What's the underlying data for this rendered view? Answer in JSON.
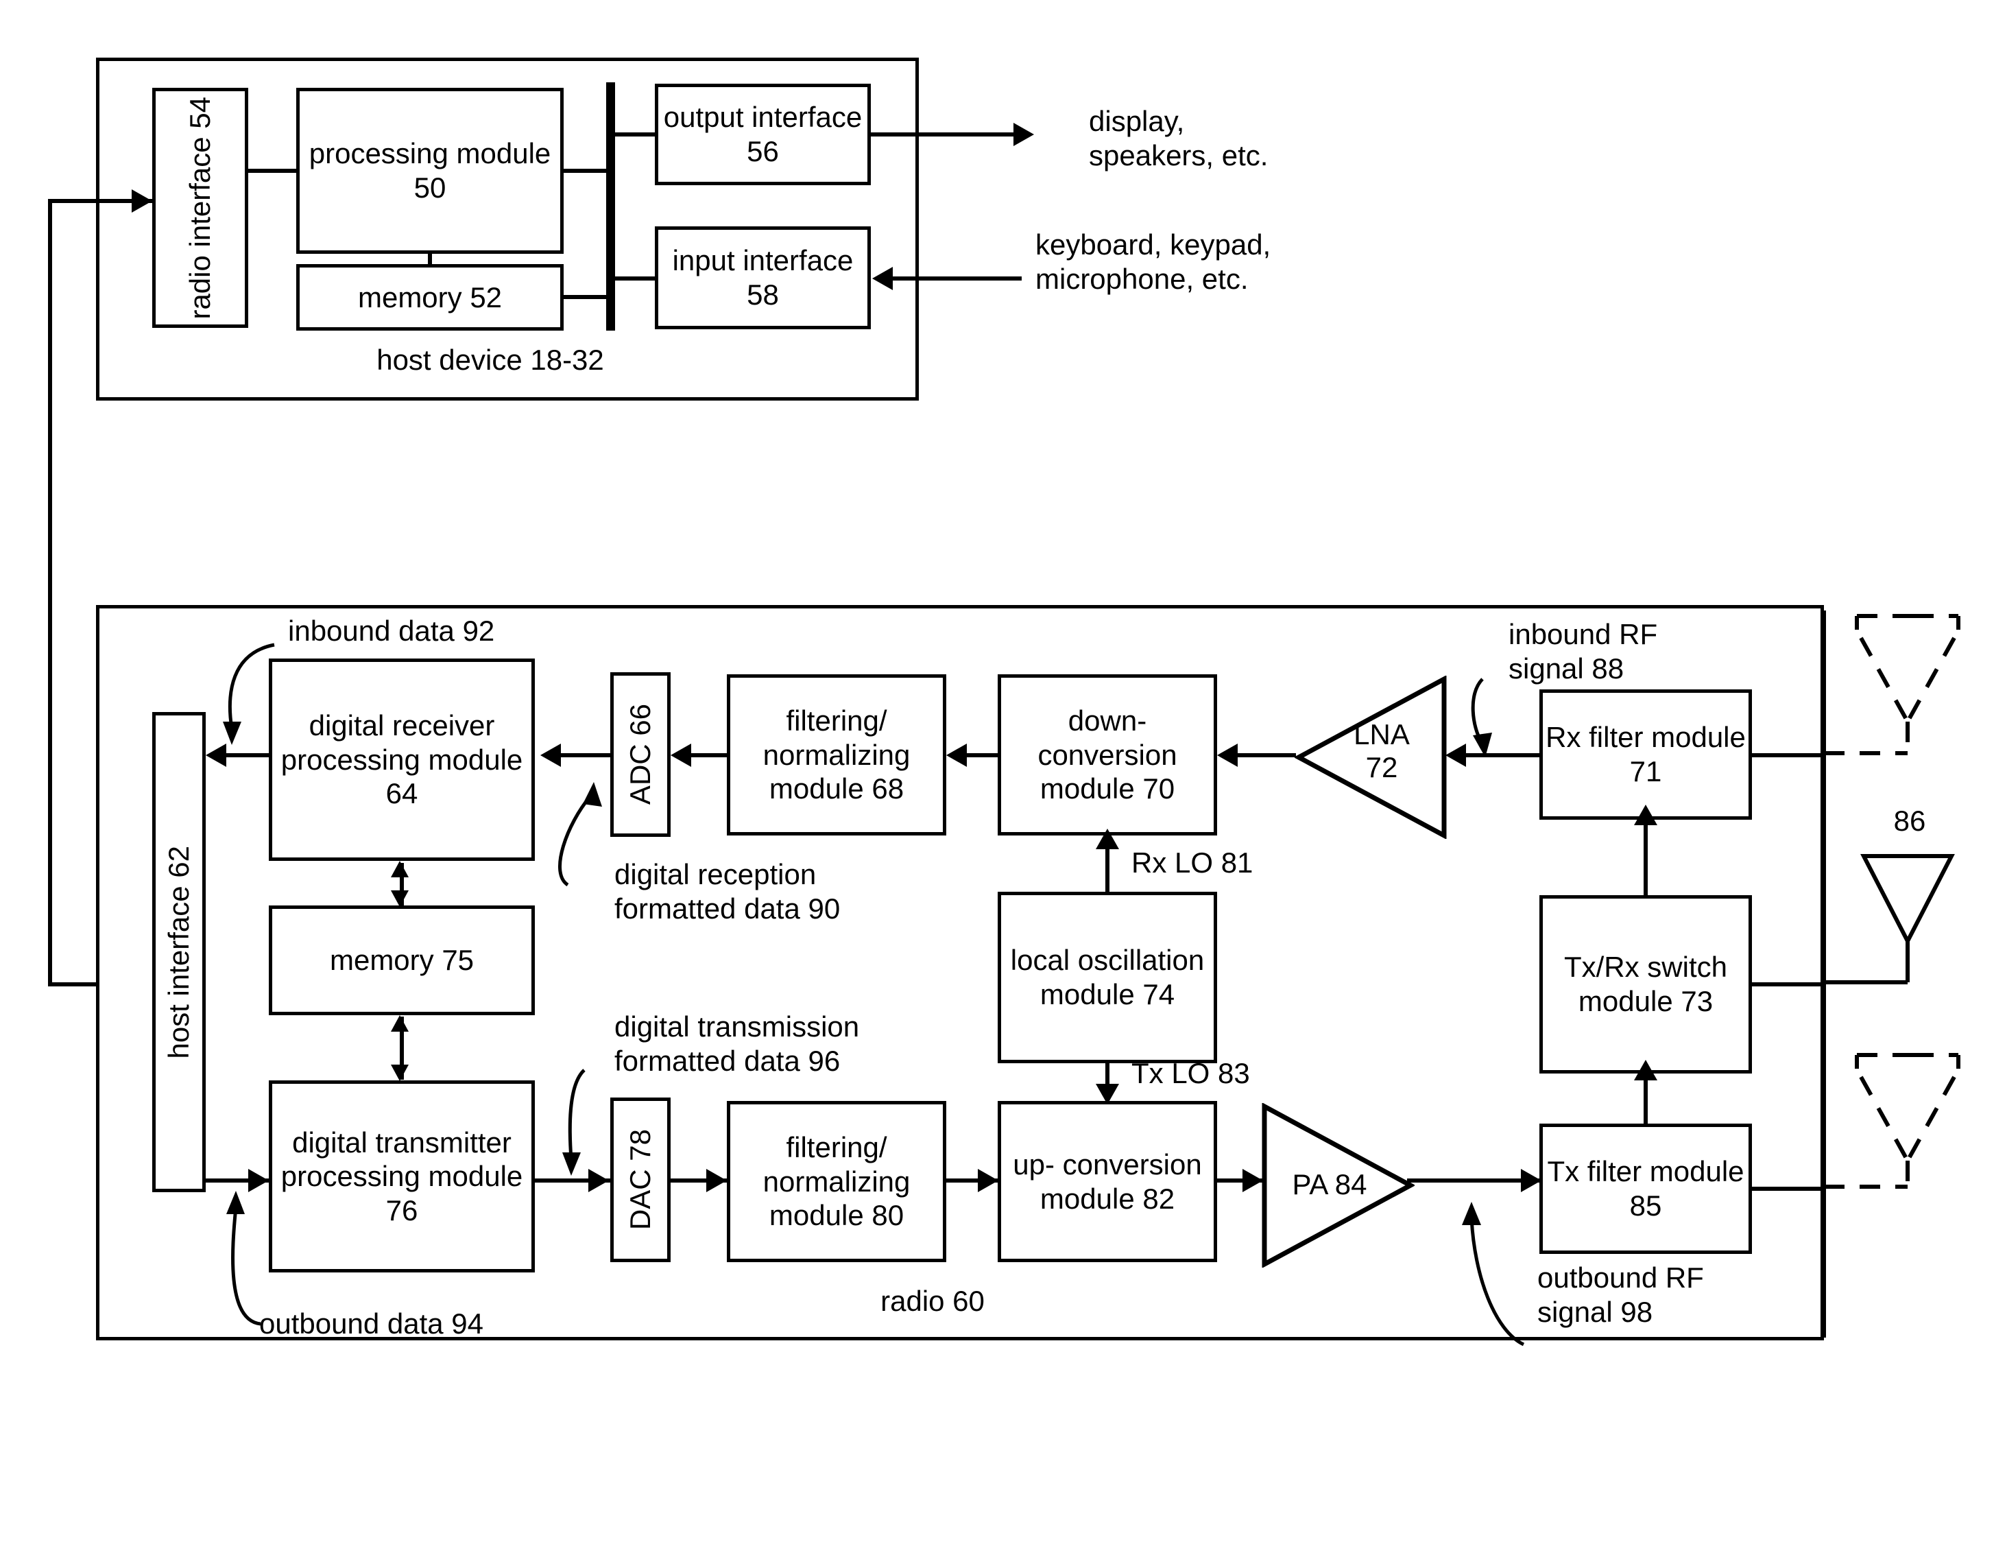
{
  "figure": {
    "host_device": {
      "caption": "host device 18-32",
      "blocks": {
        "radio_interface": "radio\ninterface 54",
        "processing_module": "processing\nmodule 50",
        "memory": "memory 52",
        "output_interface": "output\ninterface 56",
        "input_interface": "input\ninterface 58"
      },
      "external_labels": {
        "output_devices": "display,\nspeakers, etc.",
        "input_devices": "keyboard, keypad,\nmicrophone, etc."
      }
    },
    "radio": {
      "caption": "radio 60",
      "blocks": {
        "host_interface": "host interface 62",
        "digital_receiver": "digital receiver\nprocessing\nmodule 64",
        "adc": "ADC  66",
        "rx_filter_norm": "filtering/\nnormalizing\nmodule 68",
        "down_conversion": "down-\nconversion\nmodule 70",
        "lna": "LNA\n72",
        "rx_filter": "Rx filter\nmodule 71",
        "memory": "memory 75",
        "local_oscillation": "local\noscillation\nmodule 74",
        "tx_rx_switch": "Tx/Rx\nswitch\nmodule 73",
        "digital_transmitter": "digital\ntransmitter\nprocessing\nmodule 76",
        "dac": "DAC 78",
        "tx_filter_norm": "filtering/\nnormalizing\nmodule 80",
        "up_conversion": "up-\nconversion\nmodule 82",
        "pa": "PA 84",
        "tx_filter": "Tx filter\nmodule 85"
      },
      "signal_labels": {
        "inbound_data": "inbound data 92",
        "digital_reception_formatted_data": "digital reception\nformatted data 90",
        "digital_transmission_formatted_data": "digital transmission\nformatted data 96",
        "outbound_data": "outbound data 94",
        "rx_lo": "Rx LO 81",
        "tx_lo": "Tx LO 83",
        "inbound_rf_signal": "inbound RF\nsignal 88",
        "outbound_rf_signal": "outbound RF\nsignal 98",
        "antenna": "86"
      }
    },
    "colors": {
      "ink": "#000000",
      "paper": "#ffffff"
    }
  }
}
